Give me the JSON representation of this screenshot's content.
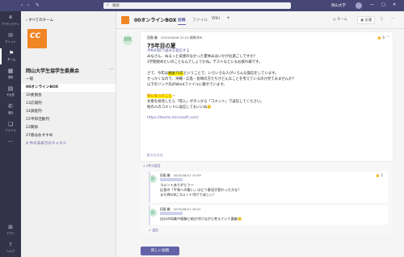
{
  "topbar": {
    "back": "‹",
    "forward": "›",
    "compose": "✎",
    "search_icon": "⌕",
    "search_placeholder": "検索",
    "org": "岡山大学",
    "minimize": "—",
    "maximize": "□",
    "close": "✕"
  },
  "rail": [
    {
      "icon": "⚘",
      "label": "アクティビティ"
    },
    {
      "icon": "✉",
      "label": "チャット"
    },
    {
      "icon": "⚑",
      "label": "チーム"
    },
    {
      "icon": "▦",
      "label": "課題"
    },
    {
      "icon": "▤",
      "label": "予定表"
    },
    {
      "icon": "✆",
      "label": "通話"
    },
    {
      "icon": "❏",
      "label": "ファイル"
    },
    {
      "icon": "···",
      "label": ""
    },
    {
      "icon": "⊞",
      "label": "アプリ"
    },
    {
      "icon": "?",
      "label": "ヘルプ"
    }
  ],
  "panel": {
    "all_teams": "‹ すべてのチーム",
    "logo_text": "CC",
    "team_name": "岡山大学生協学生委員会",
    "more": "···",
    "channels": [
      {
        "label": "一般",
        "active": false,
        "link": false
      },
      {
        "label": "00オンラインBOX",
        "active": true,
        "link": false
      },
      {
        "label": "10委員会",
        "active": false,
        "link": false
      },
      {
        "label": "13広報列",
        "active": false,
        "link": false
      },
      {
        "label": "14調査列",
        "active": false,
        "link": false
      },
      {
        "label": "15平和活動列",
        "active": false,
        "link": false
      },
      {
        "label": "23関係",
        "active": false,
        "link": false
      },
      {
        "label": "27春はおすすめ",
        "active": false,
        "link": false
      },
      {
        "label": "8 件の非表示のチャネル",
        "active": false,
        "link": true
      }
    ]
  },
  "channel": {
    "title": "00オンラインBOX",
    "tabs": [
      "投稿",
      "ファイル",
      "Wiki"
    ],
    "add_tab": "+",
    "team_btn": "◎ チーム",
    "meet_btn": "▣ 会議",
    "info_btn": "ⓘ",
    "more_btn": "···"
  },
  "post": {
    "avatar": "田窪",
    "author": "田島 厳",
    "time": "2020/08/08 22:02",
    "edited": "編集済み",
    "like": "👍 6",
    "more": "···",
    "title": "75年目の夏",
    "lines": [
      {
        "pre": "平和の取り組みを発信する",
        "hl": "",
        "post": "",
        "blue": true
      },
      {
        "pre": "みなさん、ぬるっと実感のなかった夏休みはいかがお過ごしですか？",
        "hl": "",
        "post": "",
        "blue": false
      },
      {
        "pre": "2学期始めたいのことなんでしょうかね。テストなどにもお疲れ様です。",
        "hl": "",
        "post": "",
        "blue": false
      },
      {
        "pre": "",
        "hl": "",
        "post": "",
        "blue": false
      },
      {
        "pre": "さて、今年は",
        "hl": "戦後75年",
        "post": "ということで、いろいろな人がいろんな発信をしています。",
        "blue": false
      },
      {
        "pre": "せっかくなので、",
        "hl": "",
        "post": "沖縄・広島・長崎の方たちがどんなことを考えているのか見てみませんか？",
        "blue": false
      },
      {
        "pre": "以下のリンク先のWordファイルに載せています。",
        "hl": "",
        "post": "",
        "blue": false
      },
      {
        "pre": "",
        "hl": "",
        "post": "",
        "blue": false
      },
      {
        "pre": "",
        "hl": "気になったこと",
        "post": "・",
        "blue": false
      },
      {
        "pre": "文章を拝見したら「得入」ボタンから「コメント」で返信してください。",
        "hl": "",
        "post": "",
        "blue": false
      },
      {
        "pre": "他の人のコメントに返信してもいいね🙂",
        "hl": "",
        "post": "",
        "blue": false
      }
    ],
    "link": "https://teams.microsoft.com/",
    "collapse": "折りたたむ"
  },
  "replies": {
    "header": "∨ 2件の返信",
    "items": [
      {
        "avatar": "田",
        "author": "田島 厳",
        "time": "2020/08/13 15:59",
        "like": "👍 1",
        "lines": [
          "コメントありがとう〜",
          "広島の「平和への誓い」はどう意見が変わったかな？",
          "またWordにコメント付けてほしい！"
        ]
      },
      {
        "avatar": "田",
        "author": "田島 厳",
        "time": "2020/08/13 18:31",
        "like": "",
        "lines": [
          "自分の知識や経験と結び付けながら考えていて素敵🙂"
        ]
      }
    ],
    "reply": "← 返信"
  },
  "new_post": "新しい投稿"
}
